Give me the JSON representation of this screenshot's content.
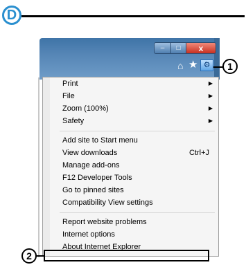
{
  "step_label": "D",
  "callouts": {
    "first": "1",
    "second": "2"
  },
  "window_buttons": {
    "minimize": "–",
    "maximize": "□",
    "close": "x"
  },
  "toolbar": {
    "home": "⌂",
    "favorites": "★",
    "tools": "⚙"
  },
  "menu": {
    "items": [
      {
        "label": "Print",
        "has_submenu": true
      },
      {
        "label": "File",
        "has_submenu": true
      },
      {
        "label": "Zoom (100%)",
        "has_submenu": true
      },
      {
        "label": "Safety",
        "has_submenu": true
      },
      {
        "label": "Add site to Start menu"
      },
      {
        "label": "View downloads",
        "shortcut": "Ctrl+J"
      },
      {
        "label": "Manage add-ons"
      },
      {
        "label": "F12 Developer Tools"
      },
      {
        "label": "Go to pinned sites"
      },
      {
        "label": "Compatibility View settings"
      },
      {
        "label": "Report website problems"
      },
      {
        "label": "Internet options"
      },
      {
        "label": "About Internet Explorer"
      }
    ]
  }
}
